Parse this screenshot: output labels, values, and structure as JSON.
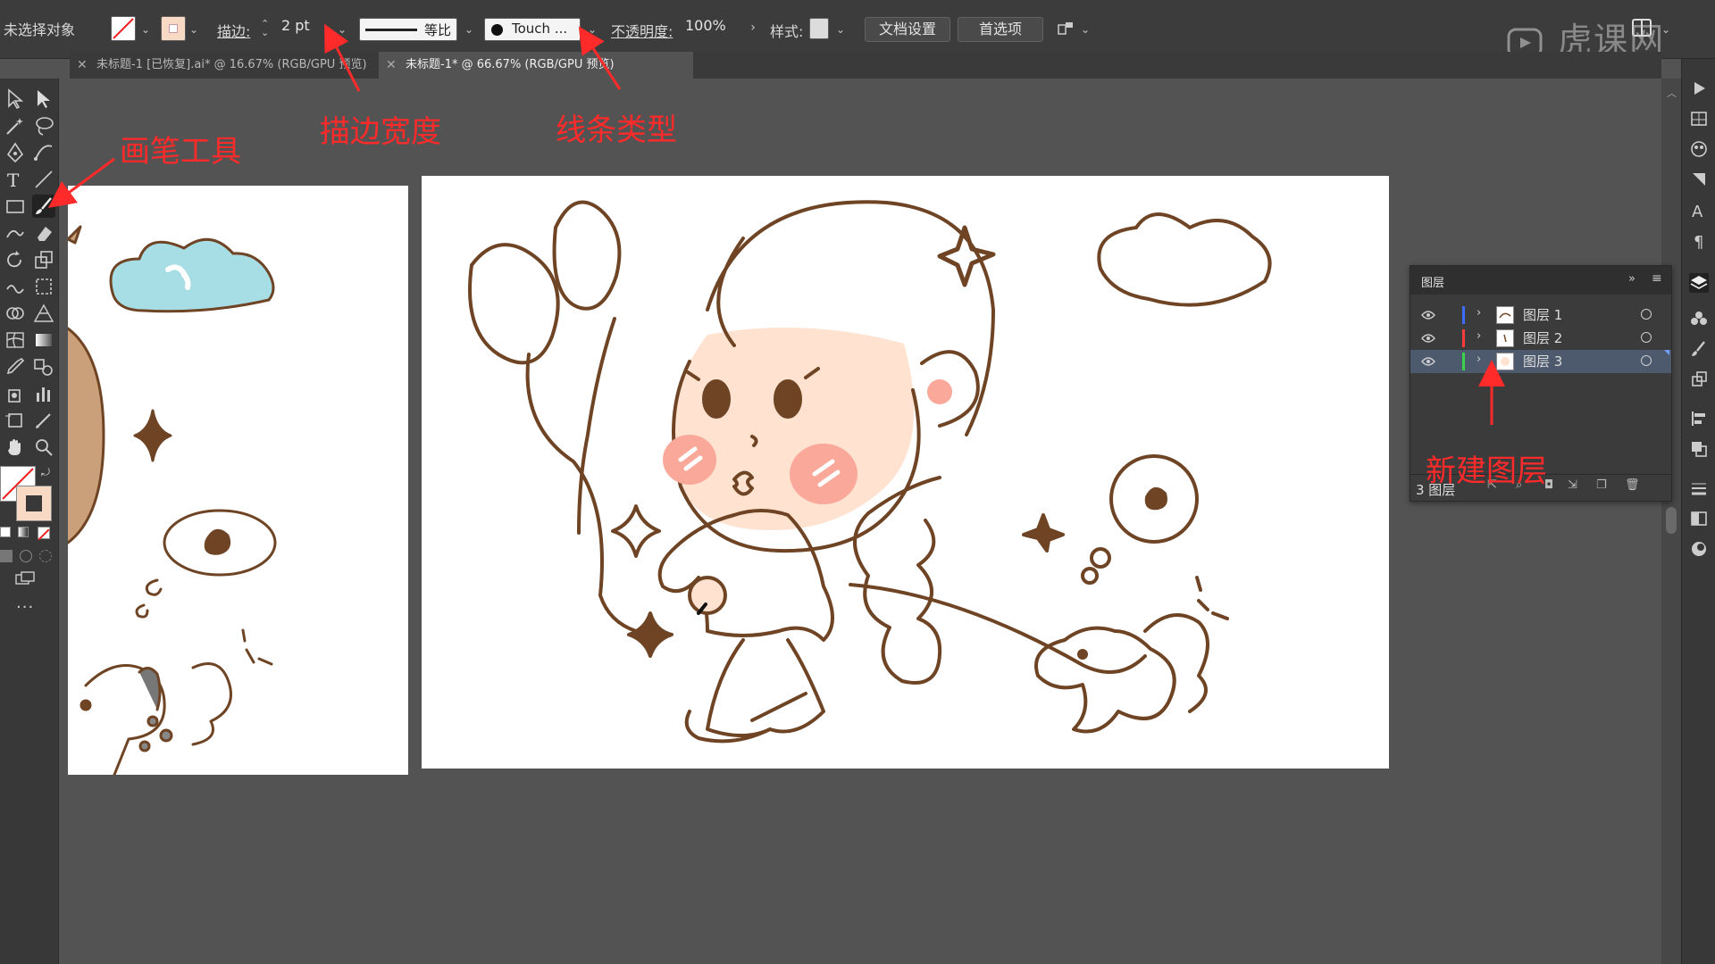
{
  "control_bar": {
    "selection": "未选择对象",
    "stroke_label": "描边:",
    "stroke_weight": "2 pt",
    "profile_label": "等比",
    "brush_name": "Touch ...",
    "opacity_label": "不透明度:",
    "opacity_value": "100%",
    "style_label": "样式:",
    "doc_setup": "文档设置",
    "preferences": "首选项"
  },
  "tabs": [
    {
      "label": "未标题-1 [已恢复].ai* @ 16.67% (RGB/GPU 预览)"
    },
    {
      "label": "未标题-1* @ 66.67% (RGB/GPU 预览)"
    }
  ],
  "layers_panel": {
    "title": "图层",
    "layers": [
      {
        "name": "图层 1",
        "color": "#3b6cff"
      },
      {
        "name": "图层 2",
        "color": "#ff3b3b"
      },
      {
        "name": "图层 3",
        "color": "#3bd14a"
      }
    ],
    "count": "3 图层"
  },
  "annotations": {
    "brush_tool": "画笔工具",
    "stroke_width": "描边宽度",
    "line_type": "线条类型",
    "new_layer": "新建图层"
  },
  "watermark": "虎课网",
  "colors": {
    "annotation": "#ff2a2a",
    "ink": "#6e4424",
    "skin": "#ffe2d0",
    "blush": "#f9a899",
    "cloud": "#a7dde4"
  }
}
